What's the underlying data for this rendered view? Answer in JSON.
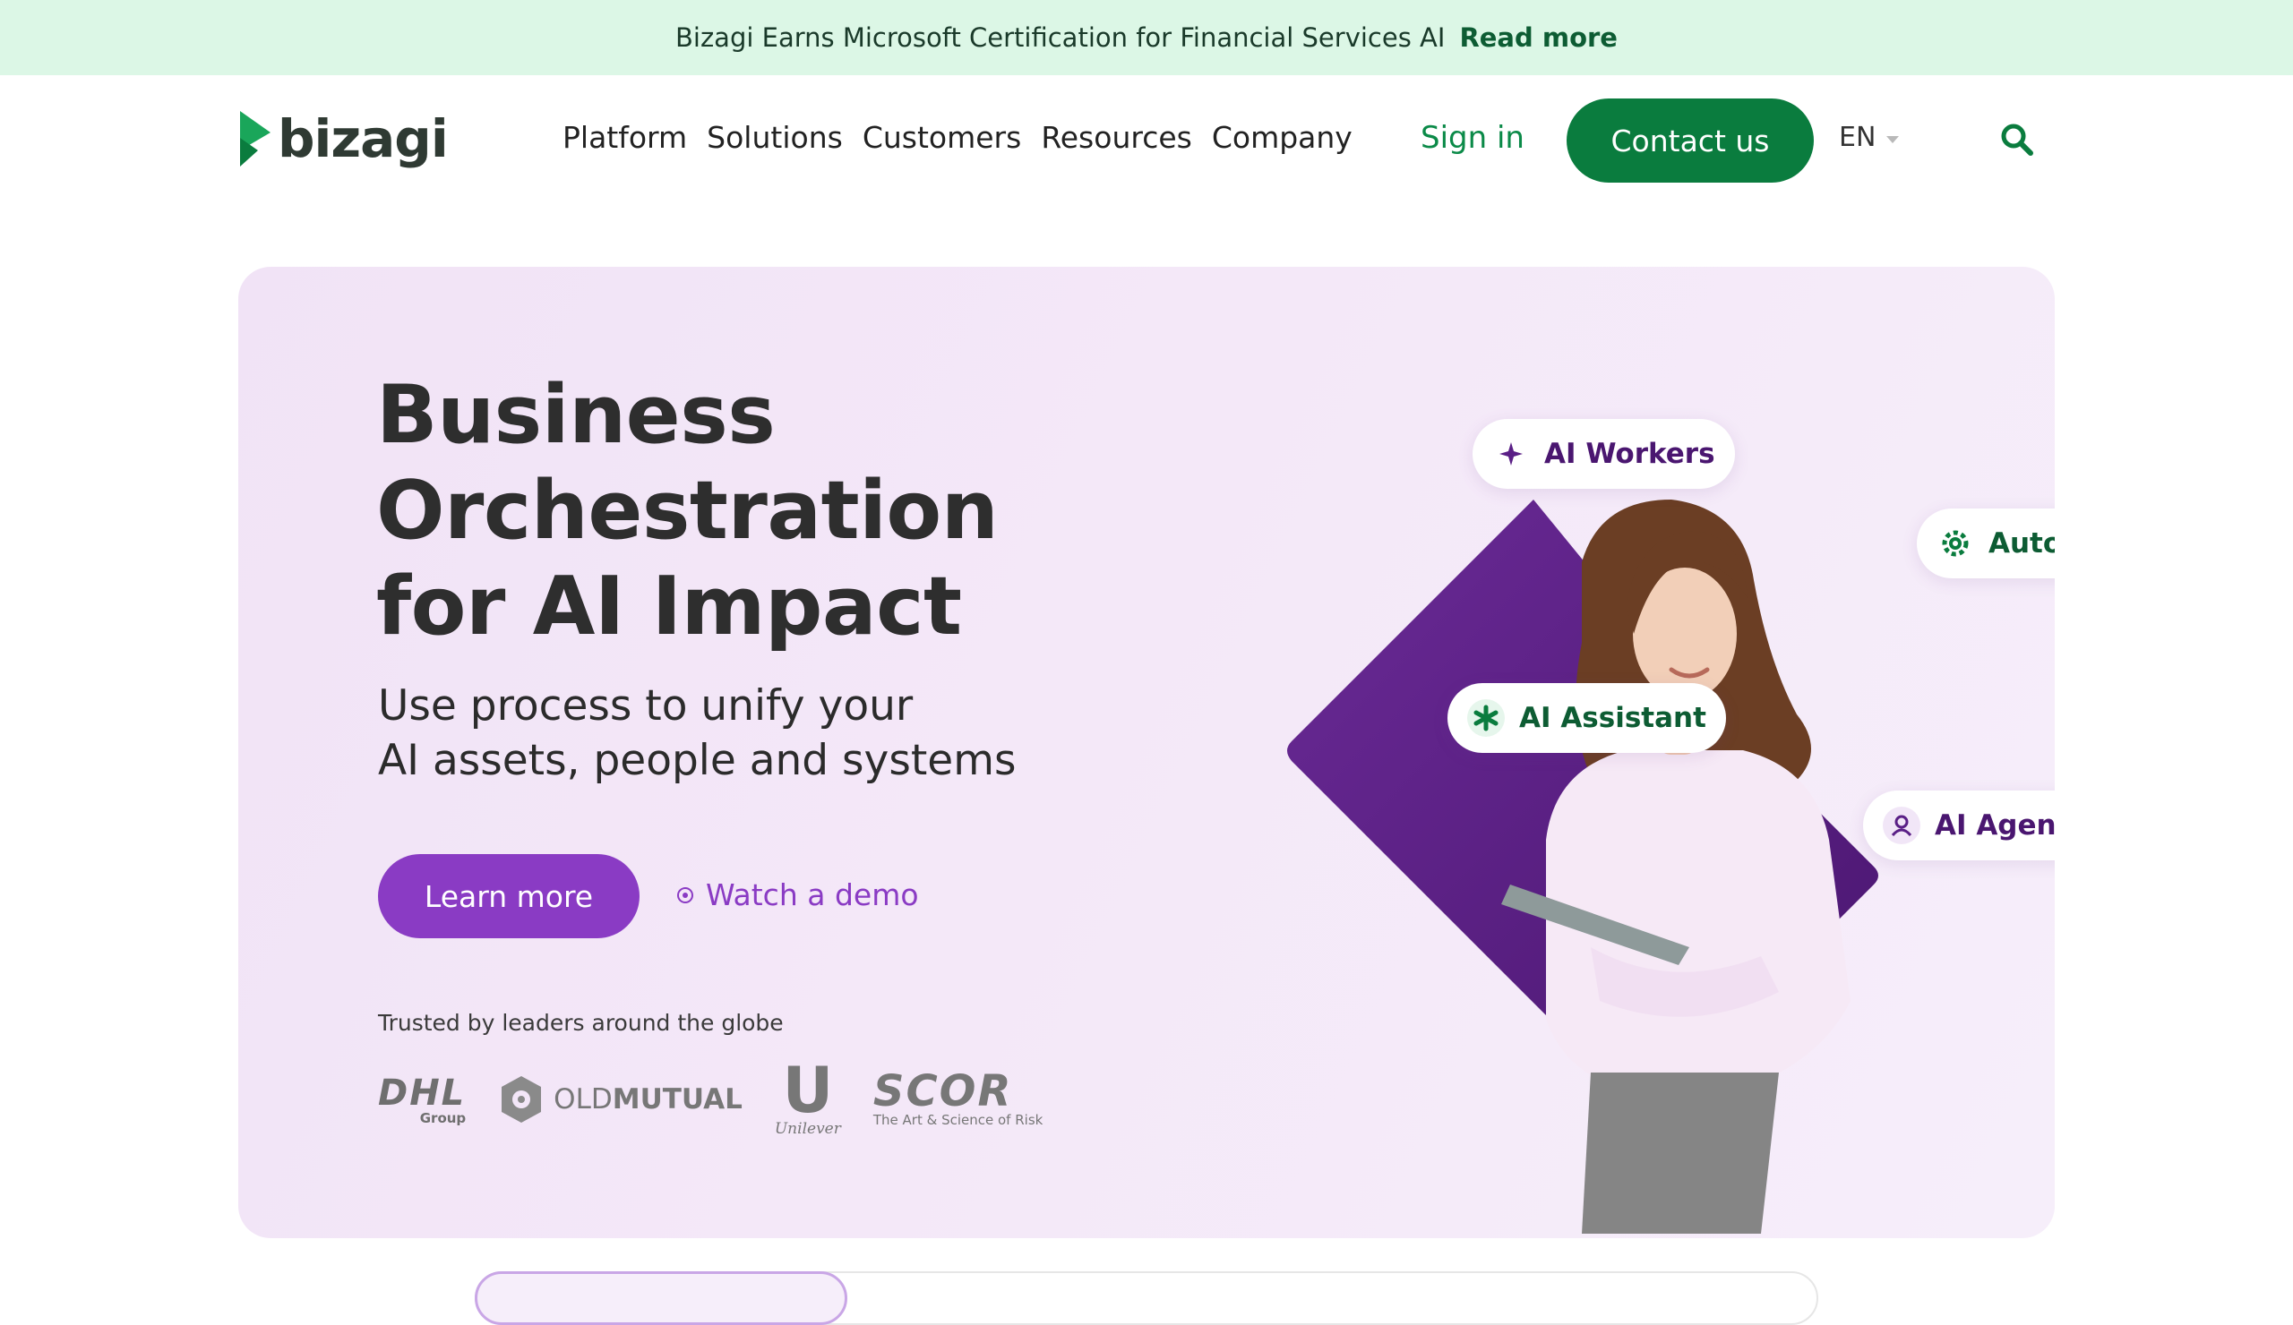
{
  "announcement": {
    "message": "Bizagi Earns Microsoft Certification for Financial Services AI",
    "link": "Read more"
  },
  "header": {
    "logo_text": "bizagi",
    "nav": [
      "Platform",
      "Solutions",
      "Customers",
      "Resources",
      "Company"
    ],
    "sign_in": "Sign in",
    "contact": "Contact us",
    "language": "EN",
    "icons": {
      "search": "search-icon",
      "language_caret": "chevron-down-icon"
    }
  },
  "hero": {
    "title_lines": [
      "Business",
      "Orchestration",
      "for AI Impact"
    ],
    "subtitle_lines": [
      "Use process to unify your",
      "AI assets, people and systems"
    ],
    "learn_more": "Learn more",
    "watch_demo": "Watch a demo",
    "trusted": "Trusted by leaders around the globe",
    "customer_logos": {
      "dhl": {
        "name": "DHL",
        "sub": "Group"
      },
      "oldmutual": {
        "old": "OLD",
        "mutual": "MUTUAL"
      },
      "unilever": {
        "mark": "U",
        "name": "Unilever"
      },
      "scor": {
        "name": "SCOR",
        "tagline": "The Art & Science of Risk"
      }
    },
    "badges": [
      {
        "label": "AI Workers",
        "icon": "sparkle-icon"
      },
      {
        "label": "Automation",
        "icon": "gear-icon"
      },
      {
        "label": "AI Assistant",
        "icon": "asterisk-icon"
      },
      {
        "label": "AI Agents",
        "icon": "agent-icon"
      }
    ]
  },
  "colors": {
    "brand_green": "#0a7c3e",
    "accent_purple": "#8a3bc4",
    "banner_bg": "#dcf7e6",
    "hero_bg": "#f3e6f8",
    "diamond": "#5a1f86"
  }
}
